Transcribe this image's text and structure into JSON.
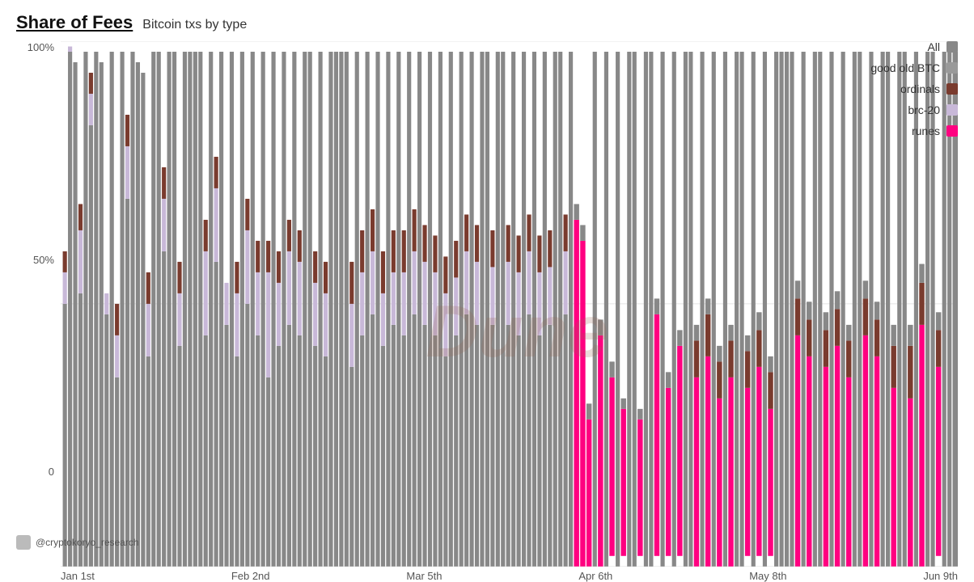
{
  "title": "Share of Fees",
  "subtitle": "Bitcoin txs by type",
  "yAxis": {
    "labels": [
      "100%",
      "50%",
      "0"
    ]
  },
  "xAxis": {
    "labels": [
      "Jan 1st",
      "Feb 2nd",
      "Mar 5th",
      "Apr 6th",
      "May 8th",
      "Jun 9th"
    ]
  },
  "legend": {
    "items": [
      {
        "label": "All",
        "color": "#888888"
      },
      {
        "label": "good old BTC",
        "color": "#999999"
      },
      {
        "label": "ordinals",
        "color": "#7a3b2e"
      },
      {
        "label": "brc-20",
        "color": "#c8b8d8"
      },
      {
        "label": "runes",
        "color": "#ff0080"
      }
    ]
  },
  "footer": {
    "handle": "@cryptokoryo_research"
  },
  "watermark": "Dune"
}
